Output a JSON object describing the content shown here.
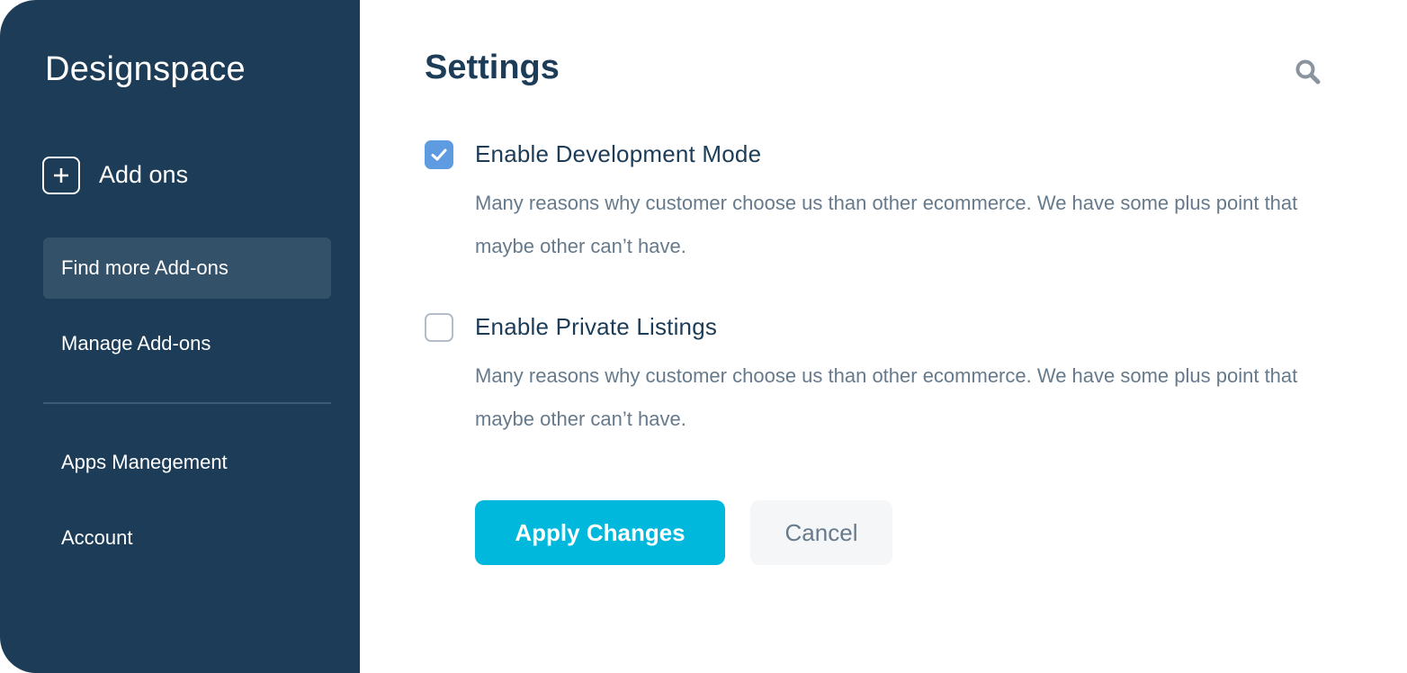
{
  "sidebar": {
    "brand": "Designspace",
    "addons_header": {
      "label": "Add ons",
      "icon": "plus-icon"
    },
    "items": [
      {
        "label": "Find more Add-ons",
        "active": true
      },
      {
        "label": "Manage Add-ons",
        "active": false
      },
      {
        "label": "Apps Manegement",
        "active": false
      },
      {
        "label": "Account",
        "active": false
      }
    ]
  },
  "main": {
    "title": "Settings",
    "search_icon": "search-icon",
    "options": [
      {
        "title": "Enable Development Mode",
        "description": "Many reasons why customer choose us than other ecommerce. We have some plus point that maybe other can’t have.",
        "checked": true
      },
      {
        "title": "Enable Private Listings",
        "description": "Many reasons why customer choose us than other ecommerce. We have some plus point that maybe other can’t have.",
        "checked": false
      }
    ],
    "actions": {
      "apply_label": "Apply Changes",
      "cancel_label": "Cancel"
    }
  },
  "colors": {
    "sidebar_bg": "#1c3c57",
    "active_item_bg": "#34516a",
    "primary": "#00b8dc",
    "checkbox_checked": "#5e9be0",
    "heading_text": "#1c3c57",
    "muted_text": "#667a8c"
  }
}
